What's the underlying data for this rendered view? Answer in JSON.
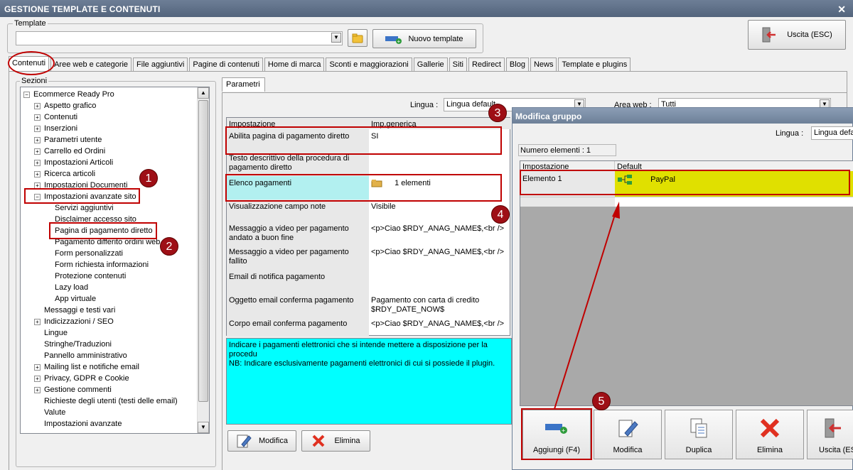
{
  "window": {
    "title": "GESTIONE TEMPLATE E CONTENUTI",
    "close_glyph": "✕"
  },
  "template": {
    "label": "Template",
    "value": "",
    "new_button": "Nuovo template",
    "exit_button": "Uscita (ESC)"
  },
  "tabs": [
    "Contenuti",
    "Aree web e categorie",
    "File aggiuntivi",
    "Pagine di contenuti",
    "Home di marca",
    "Sconti e maggiorazioni",
    "Gallerie",
    "Siti",
    "Redirect",
    "Blog",
    "News",
    "Template e plugins"
  ],
  "sections": {
    "label": "Sezioni",
    "items": [
      {
        "label": "Ecommerce Ready Pro",
        "mark": "−"
      },
      {
        "label": "Aspetto grafico",
        "mark": "+"
      },
      {
        "label": "Contenuti",
        "mark": "+"
      },
      {
        "label": "Inserzioni",
        "mark": "+"
      },
      {
        "label": "Parametri utente",
        "mark": "+"
      },
      {
        "label": "Carrello ed Ordini",
        "mark": "+"
      },
      {
        "label": "Impostazioni Articoli",
        "mark": "+"
      },
      {
        "label": "Ricerca articoli",
        "mark": "+"
      },
      {
        "label": "Impostazioni Documenti",
        "mark": "+"
      },
      {
        "label": "Impostazioni avanzate sito",
        "mark": "−"
      },
      {
        "label": "Servizi aggiuntivi",
        "mark": ""
      },
      {
        "label": "Disclaimer accesso sito",
        "mark": ""
      },
      {
        "label": "Pagina di pagamento diretto",
        "mark": ""
      },
      {
        "label": "Pagamento differito ordini web",
        "mark": ""
      },
      {
        "label": "Form personalizzati",
        "mark": ""
      },
      {
        "label": "Form richiesta informazioni",
        "mark": ""
      },
      {
        "label": "Protezione contenuti",
        "mark": ""
      },
      {
        "label": "Lazy load",
        "mark": ""
      },
      {
        "label": "App virtuale",
        "mark": ""
      },
      {
        "label": "Messaggi e testi vari",
        "mark": ""
      },
      {
        "label": "Indicizzazioni / SEO",
        "mark": "+"
      },
      {
        "label": "Lingue",
        "mark": ""
      },
      {
        "label": "Stringhe/Traduzioni",
        "mark": ""
      },
      {
        "label": "Pannello amministrativo",
        "mark": ""
      },
      {
        "label": "Mailing list e notifiche email",
        "mark": "+"
      },
      {
        "label": "Privacy, GDPR e Cookie",
        "mark": "+"
      },
      {
        "label": "Gestione commenti",
        "mark": "+"
      },
      {
        "label": "Richieste degli utenti (testi delle email)",
        "mark": ""
      },
      {
        "label": "Valute",
        "mark": ""
      },
      {
        "label": "Impostazioni avanzate",
        "mark": ""
      }
    ]
  },
  "params": {
    "tab": "Parametri",
    "lingua_label": "Lingua :",
    "lingua_value": "Lingua default",
    "area_label": "Area web :",
    "area_value": "Tutti",
    "col_setting": "Impostazione",
    "col_value": "Imp.generica",
    "rows": [
      {
        "name": "Abilita pagina di pagamento diretto",
        "value": "SI"
      },
      {
        "name": "Testo descrittivo della procedura di pagamento diretto",
        "value": ""
      },
      {
        "name": "Elenco pagamenti",
        "value": "1 elementi"
      },
      {
        "name": "Visualizzazione campo note",
        "value": "Visibile"
      },
      {
        "name": "Messaggio a video per pagamento andato a buon fine",
        "value": "<p>Ciao $RDY_ANAG_NAME$,<br />"
      },
      {
        "name": "Messaggio a video per pagamento fallito",
        "value": "<p>Ciao $RDY_ANAG_NAME$,<br />"
      },
      {
        "name": "Email di notifica pagamento",
        "value": ""
      },
      {
        "name": "Oggetto email conferma pagamento",
        "value": "Pagamento con carta di credito $RDY_DATE_NOW$"
      },
      {
        "name": "Corpo email conferma pagamento",
        "value": "<p>Ciao $RDY_ANAG_NAME$,<br />"
      }
    ],
    "description": "Indicare i pagamenti elettronici che si intende mettere a disposizione per la procedu\nNB: Indicare esclusivamente pagamenti elettronici di cui si possiede il plugin.",
    "modify_button": "Modifica",
    "delete_button": "Elimina"
  },
  "dialog": {
    "title": "Modifica gruppo",
    "lingua_label": "Lingua :",
    "lingua_value": "Lingua defa",
    "count": "Numero elementi : 1",
    "col_setting": "Impostazione",
    "col_default": "Default",
    "row_name": "Elemento 1",
    "row_value": "PayPal",
    "buttons": [
      "Aggiungi (F4)",
      "Modifica",
      "Duplica",
      "Elimina",
      "Uscita (ESC"
    ]
  },
  "badges": [
    "1",
    "2",
    "3",
    "4",
    "5"
  ],
  "colors": {
    "highlight_red": "#c00000",
    "badge": "#9e0f16",
    "cyan_desc": "#00ffff",
    "yellow_row": "#e0e000",
    "cyan_row": "#b2f0f0"
  }
}
